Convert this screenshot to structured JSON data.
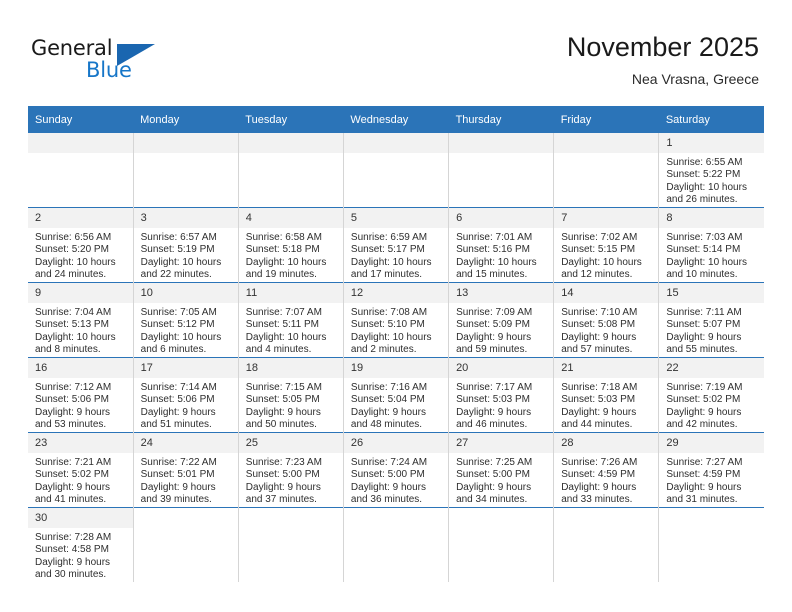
{
  "brand": {
    "name_top": "General",
    "name_bottom": "Blue",
    "accent_color": "#1676c8",
    "triangle_color": "#1a66b0"
  },
  "header": {
    "title": "November 2025",
    "subtitle": "Nea Vrasna, Greece"
  },
  "theme": {
    "header_row_bg": "#2b74b8",
    "daynum_bg": "#f2f2f2",
    "page_bg": "#ffffff"
  },
  "weekday_headers": [
    "Sunday",
    "Monday",
    "Tuesday",
    "Wednesday",
    "Thursday",
    "Friday",
    "Saturday"
  ],
  "weeks": [
    [
      {
        "day": "",
        "empty": true
      },
      {
        "day": "",
        "empty": true
      },
      {
        "day": "",
        "empty": true
      },
      {
        "day": "",
        "empty": true
      },
      {
        "day": "",
        "empty": true
      },
      {
        "day": "",
        "empty": true
      },
      {
        "day": "1",
        "sunrise": "Sunrise: 6:55 AM",
        "sunset": "Sunset: 5:22 PM",
        "daylight_line1": "Daylight: 10 hours",
        "daylight_line2": "and 26 minutes."
      }
    ],
    [
      {
        "day": "2",
        "sunrise": "Sunrise: 6:56 AM",
        "sunset": "Sunset: 5:20 PM",
        "daylight_line1": "Daylight: 10 hours",
        "daylight_line2": "and 24 minutes."
      },
      {
        "day": "3",
        "sunrise": "Sunrise: 6:57 AM",
        "sunset": "Sunset: 5:19 PM",
        "daylight_line1": "Daylight: 10 hours",
        "daylight_line2": "and 22 minutes."
      },
      {
        "day": "4",
        "sunrise": "Sunrise: 6:58 AM",
        "sunset": "Sunset: 5:18 PM",
        "daylight_line1": "Daylight: 10 hours",
        "daylight_line2": "and 19 minutes."
      },
      {
        "day": "5",
        "sunrise": "Sunrise: 6:59 AM",
        "sunset": "Sunset: 5:17 PM",
        "daylight_line1": "Daylight: 10 hours",
        "daylight_line2": "and 17 minutes."
      },
      {
        "day": "6",
        "sunrise": "Sunrise: 7:01 AM",
        "sunset": "Sunset: 5:16 PM",
        "daylight_line1": "Daylight: 10 hours",
        "daylight_line2": "and 15 minutes."
      },
      {
        "day": "7",
        "sunrise": "Sunrise: 7:02 AM",
        "sunset": "Sunset: 5:15 PM",
        "daylight_line1": "Daylight: 10 hours",
        "daylight_line2": "and 12 minutes."
      },
      {
        "day": "8",
        "sunrise": "Sunrise: 7:03 AM",
        "sunset": "Sunset: 5:14 PM",
        "daylight_line1": "Daylight: 10 hours",
        "daylight_line2": "and 10 minutes."
      }
    ],
    [
      {
        "day": "9",
        "sunrise": "Sunrise: 7:04 AM",
        "sunset": "Sunset: 5:13 PM",
        "daylight_line1": "Daylight: 10 hours",
        "daylight_line2": "and 8 minutes."
      },
      {
        "day": "10",
        "sunrise": "Sunrise: 7:05 AM",
        "sunset": "Sunset: 5:12 PM",
        "daylight_line1": "Daylight: 10 hours",
        "daylight_line2": "and 6 minutes."
      },
      {
        "day": "11",
        "sunrise": "Sunrise: 7:07 AM",
        "sunset": "Sunset: 5:11 PM",
        "daylight_line1": "Daylight: 10 hours",
        "daylight_line2": "and 4 minutes."
      },
      {
        "day": "12",
        "sunrise": "Sunrise: 7:08 AM",
        "sunset": "Sunset: 5:10 PM",
        "daylight_line1": "Daylight: 10 hours",
        "daylight_line2": "and 2 minutes."
      },
      {
        "day": "13",
        "sunrise": "Sunrise: 7:09 AM",
        "sunset": "Sunset: 5:09 PM",
        "daylight_line1": "Daylight: 9 hours",
        "daylight_line2": "and 59 minutes."
      },
      {
        "day": "14",
        "sunrise": "Sunrise: 7:10 AM",
        "sunset": "Sunset: 5:08 PM",
        "daylight_line1": "Daylight: 9 hours",
        "daylight_line2": "and 57 minutes."
      },
      {
        "day": "15",
        "sunrise": "Sunrise: 7:11 AM",
        "sunset": "Sunset: 5:07 PM",
        "daylight_line1": "Daylight: 9 hours",
        "daylight_line2": "and 55 minutes."
      }
    ],
    [
      {
        "day": "16",
        "sunrise": "Sunrise: 7:12 AM",
        "sunset": "Sunset: 5:06 PM",
        "daylight_line1": "Daylight: 9 hours",
        "daylight_line2": "and 53 minutes."
      },
      {
        "day": "17",
        "sunrise": "Sunrise: 7:14 AM",
        "sunset": "Sunset: 5:06 PM",
        "daylight_line1": "Daylight: 9 hours",
        "daylight_line2": "and 51 minutes."
      },
      {
        "day": "18",
        "sunrise": "Sunrise: 7:15 AM",
        "sunset": "Sunset: 5:05 PM",
        "daylight_line1": "Daylight: 9 hours",
        "daylight_line2": "and 50 minutes."
      },
      {
        "day": "19",
        "sunrise": "Sunrise: 7:16 AM",
        "sunset": "Sunset: 5:04 PM",
        "daylight_line1": "Daylight: 9 hours",
        "daylight_line2": "and 48 minutes."
      },
      {
        "day": "20",
        "sunrise": "Sunrise: 7:17 AM",
        "sunset": "Sunset: 5:03 PM",
        "daylight_line1": "Daylight: 9 hours",
        "daylight_line2": "and 46 minutes."
      },
      {
        "day": "21",
        "sunrise": "Sunrise: 7:18 AM",
        "sunset": "Sunset: 5:03 PM",
        "daylight_line1": "Daylight: 9 hours",
        "daylight_line2": "and 44 minutes."
      },
      {
        "day": "22",
        "sunrise": "Sunrise: 7:19 AM",
        "sunset": "Sunset: 5:02 PM",
        "daylight_line1": "Daylight: 9 hours",
        "daylight_line2": "and 42 minutes."
      }
    ],
    [
      {
        "day": "23",
        "sunrise": "Sunrise: 7:21 AM",
        "sunset": "Sunset: 5:02 PM",
        "daylight_line1": "Daylight: 9 hours",
        "daylight_line2": "and 41 minutes."
      },
      {
        "day": "24",
        "sunrise": "Sunrise: 7:22 AM",
        "sunset": "Sunset: 5:01 PM",
        "daylight_line1": "Daylight: 9 hours",
        "daylight_line2": "and 39 minutes."
      },
      {
        "day": "25",
        "sunrise": "Sunrise: 7:23 AM",
        "sunset": "Sunset: 5:00 PM",
        "daylight_line1": "Daylight: 9 hours",
        "daylight_line2": "and 37 minutes."
      },
      {
        "day": "26",
        "sunrise": "Sunrise: 7:24 AM",
        "sunset": "Sunset: 5:00 PM",
        "daylight_line1": "Daylight: 9 hours",
        "daylight_line2": "and 36 minutes."
      },
      {
        "day": "27",
        "sunrise": "Sunrise: 7:25 AM",
        "sunset": "Sunset: 5:00 PM",
        "daylight_line1": "Daylight: 9 hours",
        "daylight_line2": "and 34 minutes."
      },
      {
        "day": "28",
        "sunrise": "Sunrise: 7:26 AM",
        "sunset": "Sunset: 4:59 PM",
        "daylight_line1": "Daylight: 9 hours",
        "daylight_line2": "and 33 minutes."
      },
      {
        "day": "29",
        "sunrise": "Sunrise: 7:27 AM",
        "sunset": "Sunset: 4:59 PM",
        "daylight_line1": "Daylight: 9 hours",
        "daylight_line2": "and 31 minutes."
      }
    ],
    [
      {
        "day": "30",
        "sunrise": "Sunrise: 7:28 AM",
        "sunset": "Sunset: 4:58 PM",
        "daylight_line1": "Daylight: 9 hours",
        "daylight_line2": "and 30 minutes."
      },
      {
        "day": "",
        "blank": true
      },
      {
        "day": "",
        "blank": true
      },
      {
        "day": "",
        "blank": true
      },
      {
        "day": "",
        "blank": true
      },
      {
        "day": "",
        "blank": true
      },
      {
        "day": "",
        "blank": true
      }
    ]
  ]
}
